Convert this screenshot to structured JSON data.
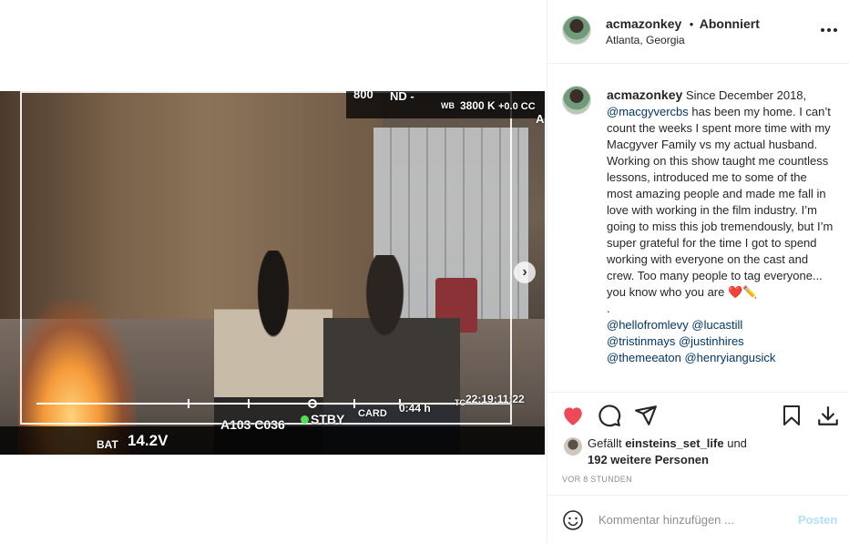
{
  "post": {
    "username": "acmazonkey",
    "separator": "•",
    "follow_status": "Abonniert",
    "location": "Atlanta, Georgia",
    "more_icon": "more-horizontal-icon"
  },
  "camera_hud": {
    "iso": "800",
    "nd": "ND -",
    "wb_label": "WB",
    "wb_value": "3800 K",
    "tint": "+0.0 CC",
    "a": "A",
    "bat_label": "BAT",
    "bat_value": "14.2V",
    "clip": "A103 C036",
    "rec_status": "STBY",
    "card": "CARD",
    "remaining": "0:44 h",
    "tc_label": "TC",
    "timecode": "22:19:11:22"
  },
  "caption": {
    "username": "acmazonkey",
    "line1": "Since December 2018,",
    "mention1": "@macgyvercbs",
    "line2": "has been my home. I can’t count the weeks I spent more time with my Macgyver Family vs my actual husband. Working on this show taught me countless lessons, introduced me to some of the most amazing people and made me fall in love with working in the film industry. I’m going to miss this job tremendously, but I’m super grateful for the time I got to spend working with everyone on the cast and crew. Too many people to tag everyone... you know who you are",
    "emoji": "❤️✏️",
    "dot": ".",
    "tags_row1": [
      "@hellofromlevy",
      "@lucastill"
    ],
    "tags_row2": [
      "@tristinmays",
      "@justinhires"
    ],
    "tags_row3": [
      "@themeeaton",
      "@henryiangusick"
    ]
  },
  "actions": {
    "like_icon": "heart-filled-icon",
    "comment_icon": "comment-icon",
    "share_icon": "paper-plane-icon",
    "save_icon": "bookmark-icon",
    "download_icon": "download-icon",
    "like_color": "#ed4956"
  },
  "likes": {
    "prefix": "Gefällt",
    "user": "einsteins_set_life",
    "connector": "und",
    "others": "192 weitere Personen"
  },
  "timestamp": "VOR 8 STUNDEN",
  "comment": {
    "placeholder": "Kommentar hinzufügen ...",
    "post_label": "Posten",
    "emoji_icon": "smiley-icon"
  }
}
